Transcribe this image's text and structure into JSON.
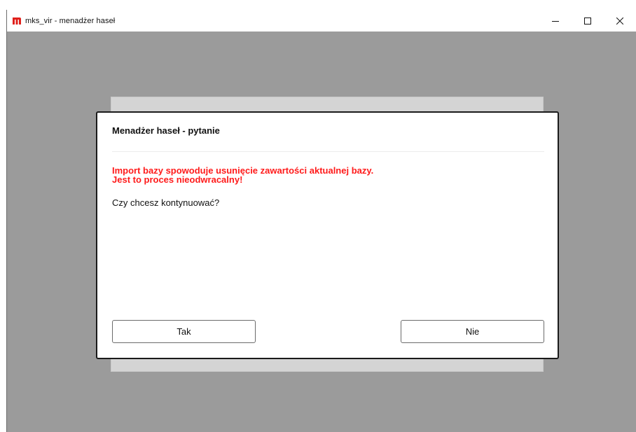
{
  "window": {
    "title": "mks_vir - menadżer haseł",
    "logo_letter": "m",
    "brand_color": "#e0201b"
  },
  "controls": {
    "minimize_icon": "minimize-icon",
    "maximize_icon": "maximize-icon",
    "close_icon": "close-icon"
  },
  "dialog": {
    "title": "Menadżer haseł - pytanie",
    "warning_line1": "Import bazy spowoduje usunięcie zawartości aktualnej bazy.",
    "warning_line2": "Jest to proces nieodwracalny!",
    "warning_color": "#ff1a1a",
    "question": "Czy chcesz kontynuować?",
    "yes_label": "Tak",
    "no_label": "Nie"
  }
}
